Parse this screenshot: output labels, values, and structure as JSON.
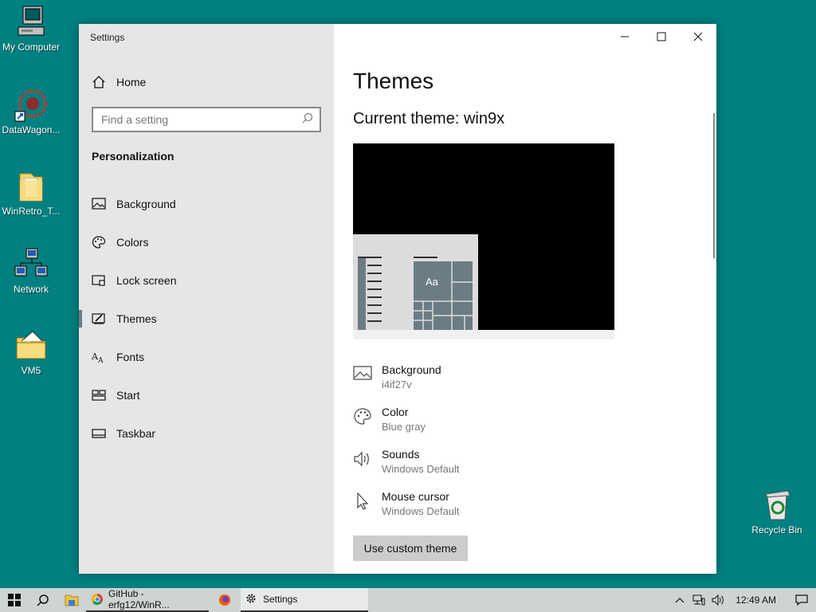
{
  "desktop": {
    "icons": [
      {
        "label": "My Computer",
        "icon": "computer-icon"
      },
      {
        "label": "DataWagon...",
        "icon": "datawagon-icon"
      },
      {
        "label": "WinRetro_T...",
        "icon": "folder-icon"
      },
      {
        "label": "Network",
        "icon": "network-icon"
      },
      {
        "label": "VM5",
        "icon": "folder-icon"
      },
      {
        "label": "Recycle Bin",
        "icon": "recycle-bin-icon"
      }
    ]
  },
  "window": {
    "app_title": "Settings",
    "sidebar": {
      "home_label": "Home",
      "search_placeholder": "Find a setting",
      "section_title": "Personalization",
      "items": [
        {
          "label": "Background",
          "icon": "background-icon"
        },
        {
          "label": "Colors",
          "icon": "palette-icon"
        },
        {
          "label": "Lock screen",
          "icon": "lock-screen-icon"
        },
        {
          "label": "Themes",
          "icon": "themes-icon",
          "active": true
        },
        {
          "label": "Fonts",
          "icon": "fonts-icon"
        },
        {
          "label": "Start",
          "icon": "start-icon"
        },
        {
          "label": "Taskbar",
          "icon": "taskbar-icon"
        }
      ]
    },
    "content": {
      "page_title": "Themes",
      "current_theme": "Current theme: win9x",
      "preview_sample": "Aa",
      "properties": [
        {
          "name": "Background",
          "value": "i4if27v",
          "icon": "picture-icon"
        },
        {
          "name": "Color",
          "value": "Blue gray",
          "icon": "palette-icon"
        },
        {
          "name": "Sounds",
          "value": "Windows Default",
          "icon": "speaker-icon"
        },
        {
          "name": "Mouse cursor",
          "value": "Windows Default",
          "icon": "cursor-icon"
        }
      ],
      "custom_button": "Use custom theme"
    }
  },
  "taskbar": {
    "tasks": [
      {
        "label": "GitHub - erfg12/WinR...",
        "icon": "chrome-icon"
      },
      {
        "label": "Settings",
        "icon": "gear-icon",
        "active": true
      }
    ],
    "clock": "12:49 AM"
  },
  "colors": {
    "desktop": "#008080",
    "sidebar": "#e6e6e6",
    "accent_tile": "#6b7c85",
    "taskbar": "#cfd3d3"
  }
}
